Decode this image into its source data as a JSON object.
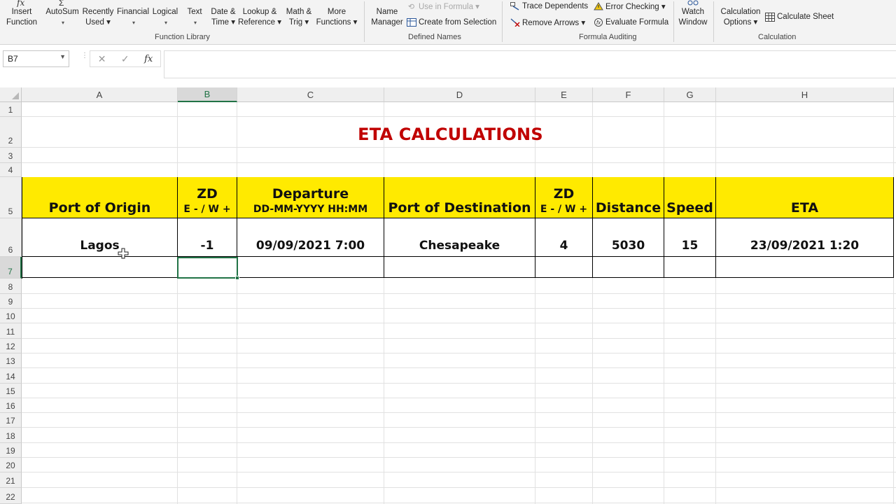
{
  "ribbon": {
    "buttons": [
      {
        "id": "insert-function",
        "line1": "Insert",
        "line2": "Function"
      },
      {
        "id": "autosum",
        "line1": "AutoSum",
        "line2": "▾"
      },
      {
        "id": "recently-used",
        "line1": "Recently",
        "line2": "Used ▾"
      },
      {
        "id": "financial",
        "line1": "Financial",
        "line2": "▾"
      },
      {
        "id": "logical",
        "line1": "Logical",
        "line2": "▾"
      },
      {
        "id": "text",
        "line1": "Text",
        "line2": "▾"
      },
      {
        "id": "date-time",
        "line1": "Date &",
        "line2": "Time ▾"
      },
      {
        "id": "lookup-reference",
        "line1": "Lookup &",
        "line2": "Reference ▾"
      },
      {
        "id": "math-trig",
        "line1": "Math &",
        "line2": "Trig ▾"
      },
      {
        "id": "more-functions",
        "line1": "More",
        "line2": "Functions ▾"
      },
      {
        "id": "name-manager",
        "line1": "Name",
        "line2": "Manager"
      },
      {
        "id": "watch-window",
        "line1": "Watch",
        "line2": "Window"
      },
      {
        "id": "calculation-options",
        "line1": "Calculation",
        "line2": "Options ▾"
      }
    ],
    "small": {
      "use_in_formula": "Use in Formula ▾",
      "create_from_selection": "Create from Selection",
      "trace_dependents": "Trace Dependents",
      "remove_arrows": "Remove Arrows  ▾",
      "error_checking": "Error Checking  ▾",
      "evaluate_formula": "Evaluate Formula",
      "calculate_sheet": "Calculate Sheet"
    },
    "groups": {
      "function_library": "Function Library",
      "defined_names": "Defined Names",
      "formula_auditing": "Formula Auditing",
      "calculation": "Calculation"
    }
  },
  "formula_bar": {
    "name_box": "B7",
    "cancel": "✕",
    "enter": "✓",
    "fx": "fx",
    "formula": ""
  },
  "columns": [
    "A",
    "B",
    "C",
    "D",
    "E",
    "F",
    "G",
    "H"
  ],
  "rows": [
    "1",
    "2",
    "3",
    "4",
    "5",
    "6",
    "7",
    "8",
    "9",
    "10",
    "11",
    "12",
    "13",
    "14",
    "15",
    "16",
    "17",
    "18",
    "19",
    "20",
    "21",
    "22"
  ],
  "sheet": {
    "title": "ETA CALCULATIONS",
    "headers": {
      "port_origin": "Port of Origin",
      "zd1_top": "ZD",
      "zd1_bottom": "E -  / W +",
      "departure_top": "Departure",
      "departure_bottom": "DD-MM-YYYY HH:MM",
      "port_destination": "Port of Destination",
      "zd2_top": "ZD",
      "zd2_bottom": "E -  / W +",
      "distance": "Distance",
      "speed": "Speed",
      "eta": "ETA"
    },
    "row6": {
      "port_origin": "Lagos",
      "zd1": "-1",
      "departure": "09/09/2021 7:00",
      "port_destination": "Chesapeake",
      "zd2": "4",
      "distance": "5030",
      "speed": "15",
      "eta": "23/09/2021 1:20"
    }
  },
  "colors": {
    "title": "#c00000",
    "header_fill": "#ffea00",
    "selection": "#217346"
  }
}
